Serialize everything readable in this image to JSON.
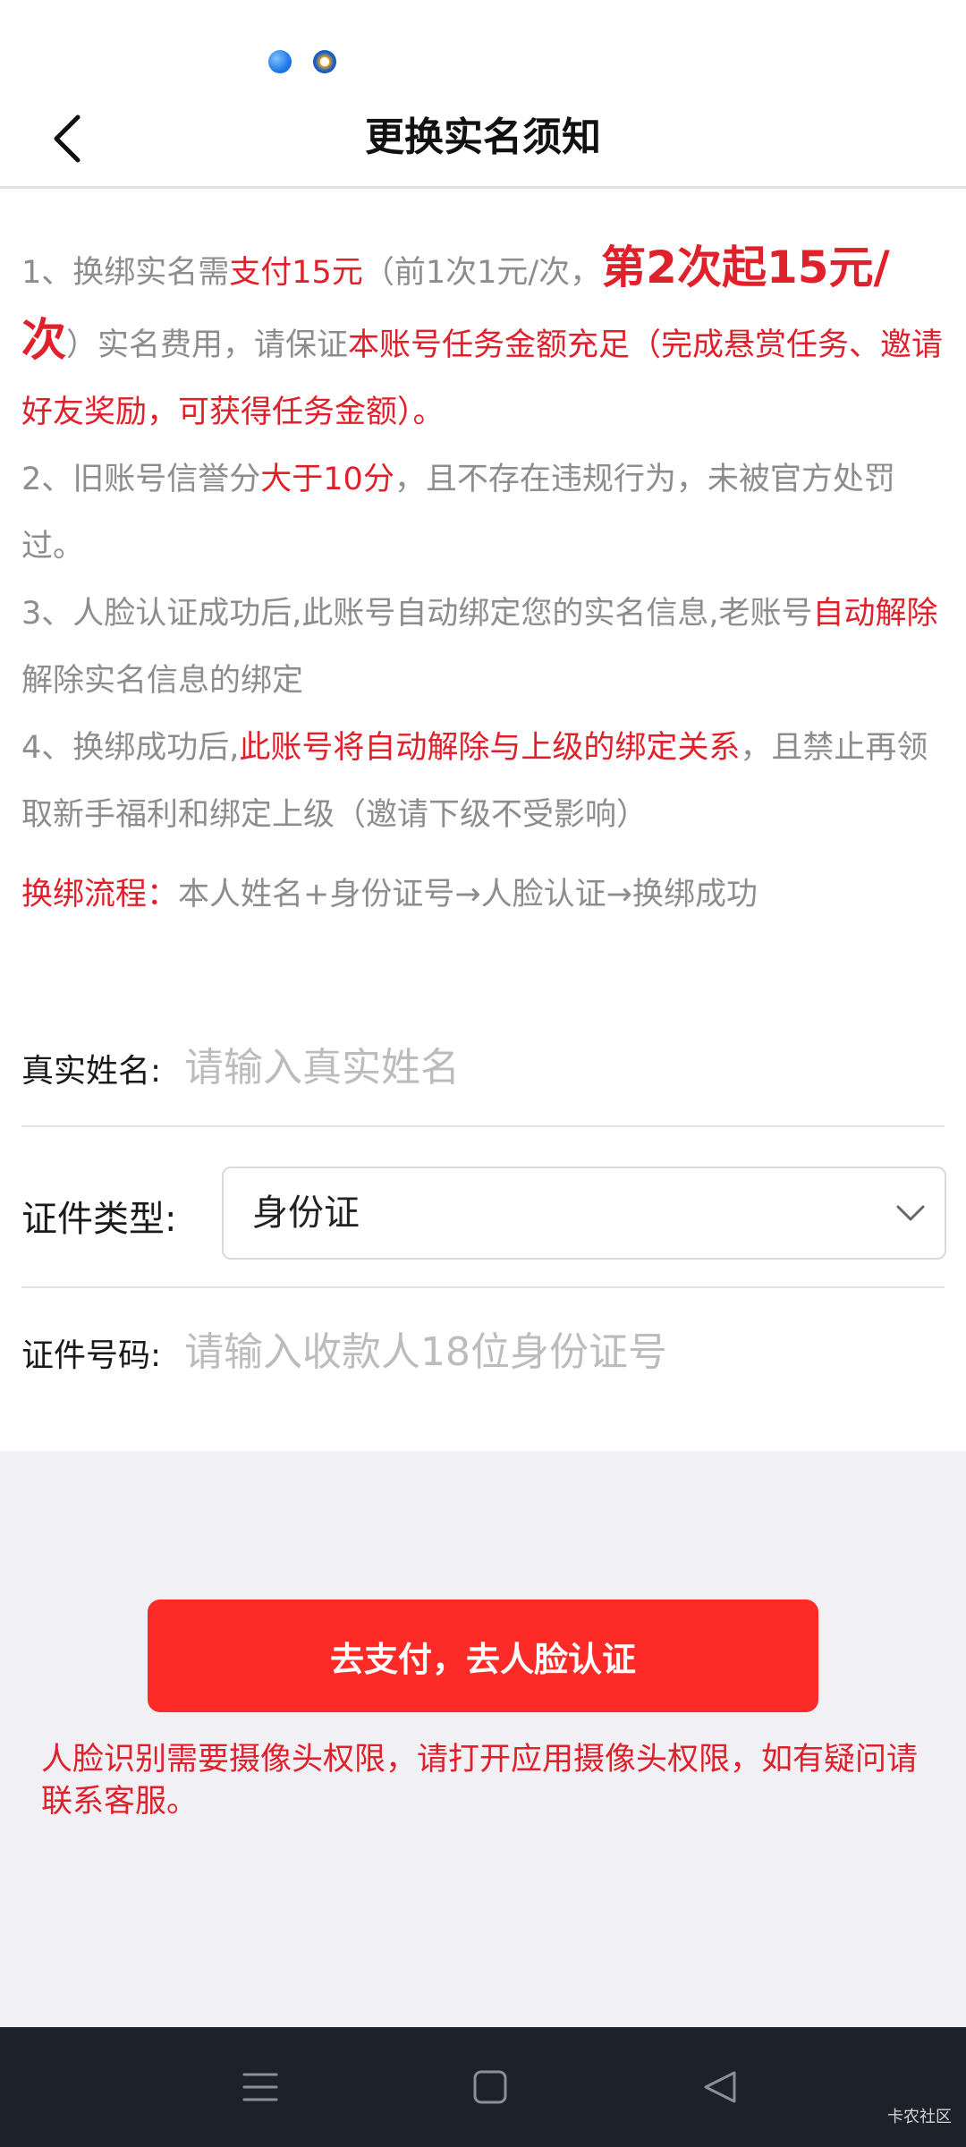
{
  "nav": {
    "title": "更换实名须知",
    "back_icon": "chevron-left-icon"
  },
  "notice": {
    "p1": {
      "a": "1、换绑实名需",
      "b": "支付15元",
      "c": "（前1次1元/次，",
      "d": "第2次起15元/次",
      "e": "）实名费用，请保证",
      "f": "本账号任务金额充足（完成悬赏任务、邀请好友奖励，可获得任务金额）。"
    },
    "p2": {
      "a": "2、旧账号信誉分",
      "b": "大于10分",
      "c": "，且不存在违规行为，未被官方处罚过。"
    },
    "p3": {
      "a": "3、人脸认证成功后,此账号自动绑定您的实名信息,老账号",
      "b": "自动解除",
      "c": "解除实名信息的绑定"
    },
    "p4": {
      "a": "4、换绑成功后,",
      "b": "此账号将自动解除与上级的绑定关系",
      "c": "，且禁止再领取新手福利和绑定上级（邀请下级不受影响）"
    },
    "flow": {
      "label": "换绑流程：",
      "steps": "本人姓名+身份证号→人脸认证→换绑成功"
    }
  },
  "form": {
    "name": {
      "label": "真实姓名:",
      "value": "",
      "placeholder": "请输入真实姓名"
    },
    "id_type": {
      "label": "证件类型:",
      "selected": "身份证"
    },
    "id_number": {
      "label": "证件号码:",
      "value": "",
      "placeholder": "请输入收款人18位身份证号"
    }
  },
  "actions": {
    "pay_label": "去支付，去人脸认证",
    "camera_note": "人脸识别需要摄像头权限，请打开应用摄像头权限，如有疑问请联系客服。"
  },
  "watermark": "卡农社区",
  "colors": {
    "accent_red": "#e0202a",
    "button_red": "#fc2b27",
    "nav_bar_dark": "#1d2129"
  }
}
